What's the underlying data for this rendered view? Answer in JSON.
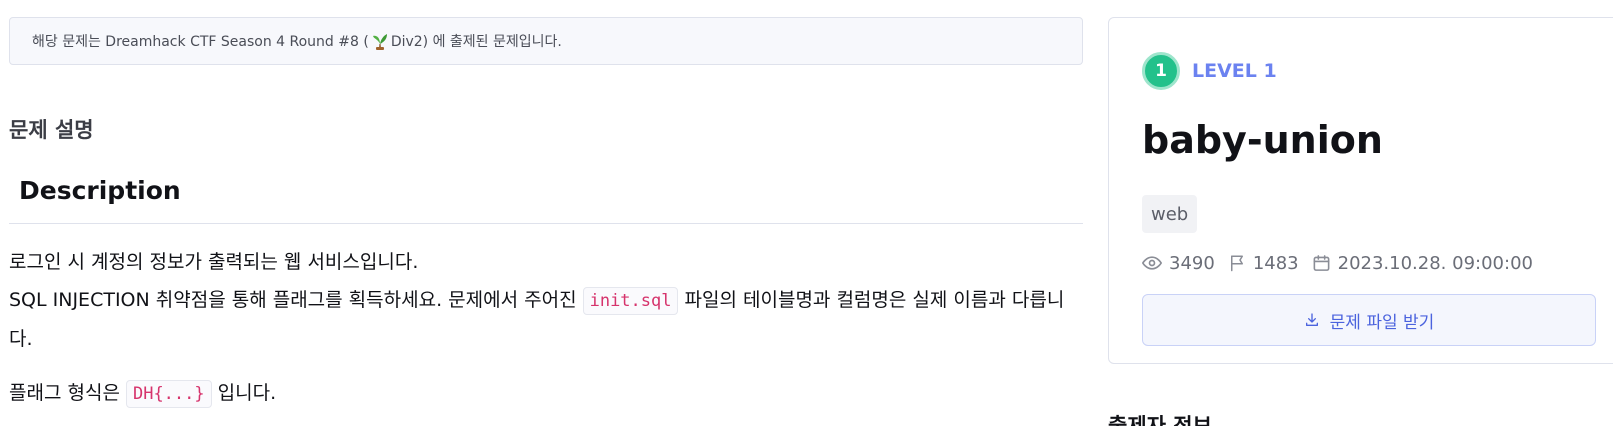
{
  "notice": {
    "prefix": "해당 문제는 Dreamhack CTF Season 4 Round #8 (",
    "suffix": "Div2) 에 출제된 문제입니다."
  },
  "section_title": "문제 설명",
  "description": {
    "heading": "Description",
    "line1": "로그인 시 계정의 정보가 출력되는 웹 서비스입니다.",
    "line2_before": "SQL INJECTION 취약점을 통해 플래그를 획득하세요. 문제에서 주어진 ",
    "line2_code": "init.sql",
    "line2_after": " 파일의 테이블명과 컬럼명은 실제 이름과 다릅니다.",
    "line3_before": "플래그 형식은 ",
    "line3_code": "DH{...}",
    "line3_after": " 입니다."
  },
  "card": {
    "level_number": "1",
    "level_label": "LEVEL 1",
    "title": "baby-union",
    "tag": "web",
    "views": "3490",
    "solves": "1483",
    "date": "2023.10.28. 09:00:00",
    "download_label": "문제 파일 받기"
  },
  "author_section_title": "출제자 정보",
  "colors": {
    "accent": "#6b82f0",
    "level_badge": "#23c18b",
    "code_text": "#d6336c"
  },
  "icons": [
    "sprout-icon",
    "eye-icon",
    "flag-icon",
    "calendar-icon",
    "download-icon"
  ]
}
